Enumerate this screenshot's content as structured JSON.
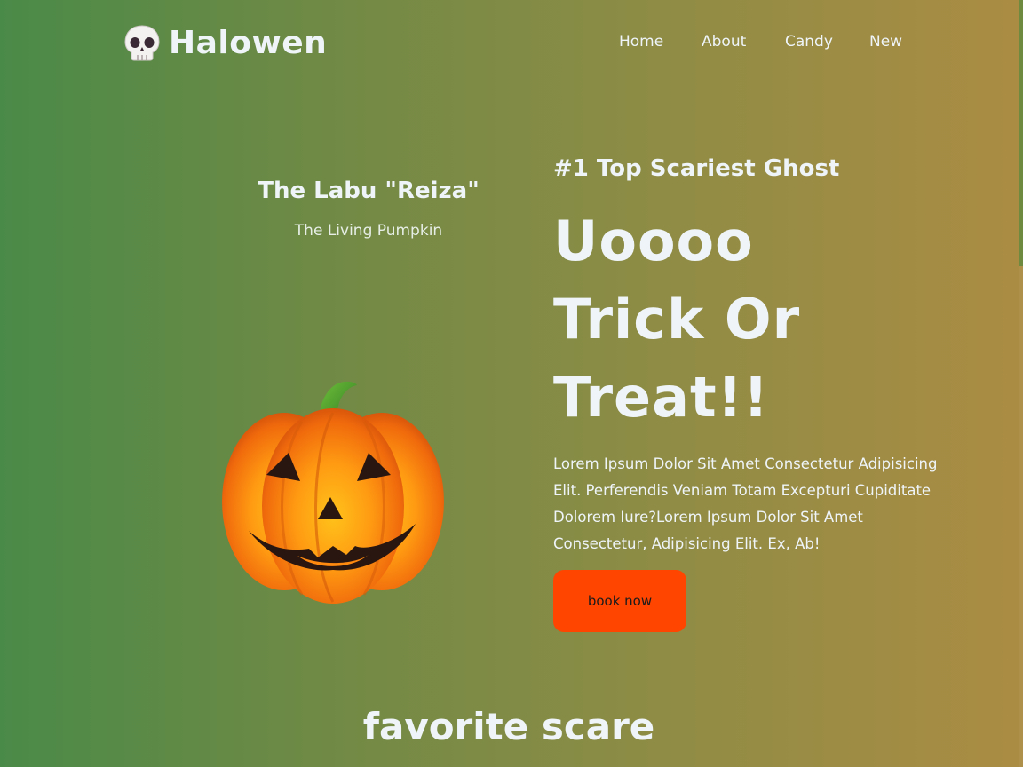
{
  "header": {
    "logo_icon": "skull-icon",
    "logo_text": "Halowen",
    "nav": [
      {
        "label": "Home"
      },
      {
        "label": "About"
      },
      {
        "label": "Candy"
      },
      {
        "label": "New"
      }
    ]
  },
  "hero": {
    "left_title": "The Labu \"Reiza\"",
    "left_subtitle": "The Living Pumpkin",
    "image_icon": "jack-o-lantern-icon",
    "eyebrow": "#1 Top Scariest Ghost",
    "headline_lines": [
      "Uoooo",
      "Trick Or",
      "Treat!!"
    ],
    "body": "Lorem Ipsum Dolor Sit Amet Consectetur Adipisicing Elit. Perferendis Veniam Totam Excepturi Cupiditate Dolorem Iure?Lorem Ipsum Dolor Sit Amet Consectetur, Adipisicing Elit. Ex, Ab!",
    "cta_label": "book now"
  },
  "section": {
    "title": "favorite scare"
  },
  "colors": {
    "background_left": "#4a8a48",
    "background_right": "#ab8c43",
    "text": "#eef4f8",
    "cta": "#ff4500"
  }
}
